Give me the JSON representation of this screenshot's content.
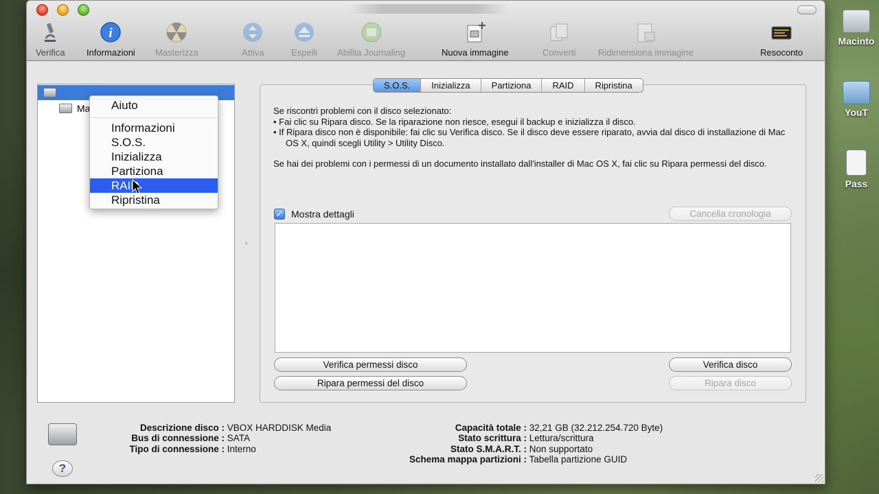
{
  "desktop": {
    "icons": [
      "Macinto",
      "YouT",
      "Pass"
    ]
  },
  "toolbar": {
    "items": [
      {
        "label": "Verifica",
        "icon": "microscope-icon"
      },
      {
        "label": "Informazioni",
        "icon": "info-icon"
      },
      {
        "label": "Masterizza",
        "icon": "burn-icon"
      },
      {
        "label": "Attiva",
        "icon": "mount-icon"
      },
      {
        "label": "Espelli",
        "icon": "eject-icon"
      },
      {
        "label": "Abilita Journaling",
        "icon": "journal-icon"
      },
      {
        "label": "Nuova immagine",
        "icon": "new-image-icon"
      },
      {
        "label": "Converti",
        "icon": "convert-icon"
      },
      {
        "label": "Ridimensiona immagine",
        "icon": "resize-image-icon"
      },
      {
        "label": "Resoconto",
        "icon": "log-icon"
      }
    ]
  },
  "sidebar": {
    "items": [
      {
        "name": "",
        "selected": true
      },
      {
        "name": "Ma",
        "selected": false
      }
    ]
  },
  "context_menu": {
    "items": [
      "Aiuto",
      "Informazioni",
      "S.O.S.",
      "Inizializza",
      "Partiziona",
      "RAID",
      "Ripristina"
    ],
    "highlighted": "RAID"
  },
  "tabs": [
    "S.O.S.",
    "Inizializza",
    "Partiziona",
    "RAID",
    "Ripristina"
  ],
  "active_tab": "S.O.S.",
  "sos": {
    "intro": "Se riscontri problemi con il disco selezionato:",
    "bullet1": "• Fai clic su Ripara disco. Se la riparazione non riesce, esegui il backup e inizializza il disco.",
    "bullet2": "• If Ripara disco non è disponibile: fai clic su Verifica disco. Se il disco deve essere riparato, avvia dal disco di installazione di Mac OS X, quindi scegli Utility > Utility Disco.",
    "permissions": "Se hai dei problemi con i permessi di un documento installato dall'installer di Mac OS X, fai clic su Ripara permessi del disco.",
    "show_details": "Mostra dettagli",
    "clear_history": "Cancella cronologia",
    "verify_permissions": "Verifica permessi disco",
    "repair_permissions": "Ripara permessi del disco",
    "verify_disk": "Verifica disco",
    "repair_disk": "Ripara disco"
  },
  "info": {
    "desc_label": "Descrizione disco :",
    "desc_value": "VBOX HARDDISK Media",
    "bus_label": "Bus di connessione :",
    "bus_value": "SATA",
    "type_label": "Tipo di connessione :",
    "type_value": "Interno",
    "cap_label": "Capacità totale :",
    "cap_value": "32,21 GB (32.212.254.720 Byte)",
    "write_label": "Stato scrittura :",
    "write_value": "Lettura/scrittura",
    "smart_label": "Stato S.M.A.R.T. :",
    "smart_value": "Non supportato",
    "scheme_label": "Schema mappa partizioni :",
    "scheme_value": "Tabella partizione GUID"
  },
  "help": "?"
}
